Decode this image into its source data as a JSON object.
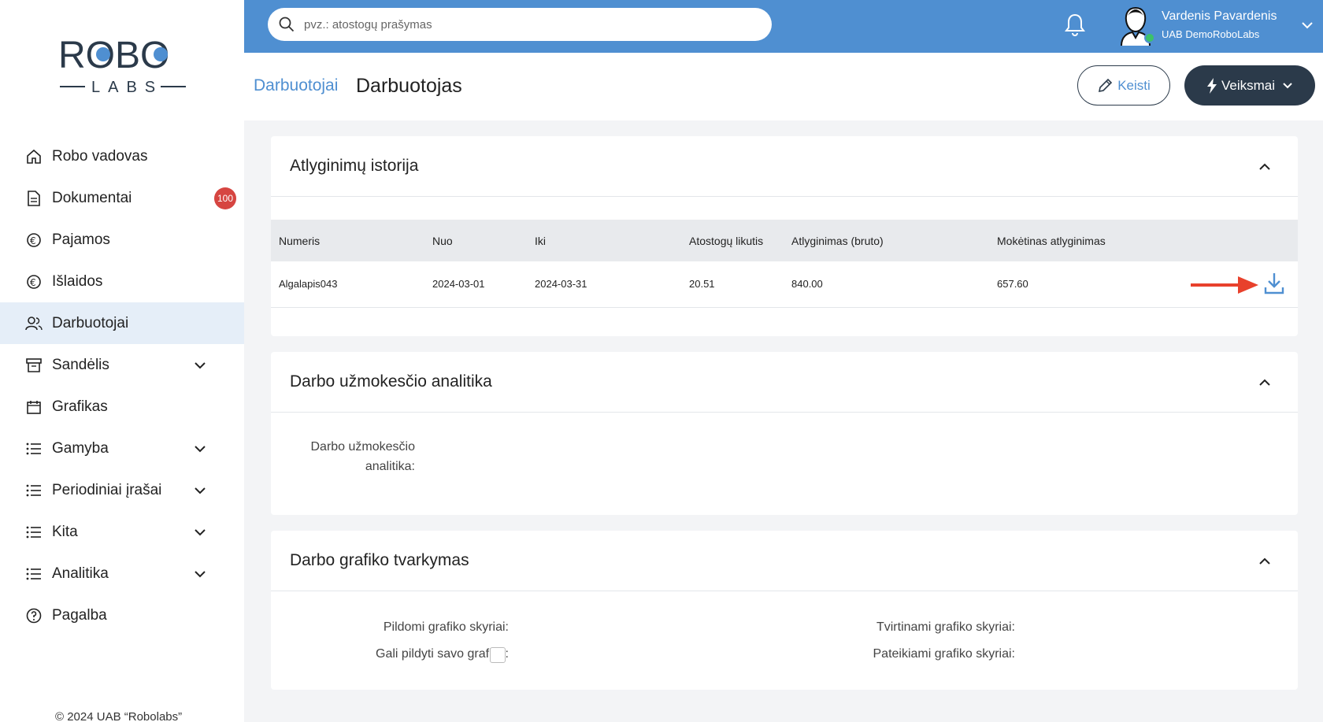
{
  "sidebar": {
    "items": [
      {
        "label": "Robo vadovas",
        "icon": "home-icon"
      },
      {
        "label": "Dokumentai",
        "icon": "document-icon",
        "badge": "100"
      },
      {
        "label": "Pajamos",
        "icon": "euro-income-icon"
      },
      {
        "label": "Išlaidos",
        "icon": "euro-expense-icon"
      },
      {
        "label": "Darbuotojai",
        "icon": "users-icon",
        "active": true
      },
      {
        "label": "Sandėlis",
        "icon": "archive-icon",
        "expandable": true
      },
      {
        "label": "Grafikas",
        "icon": "calendar-icon"
      },
      {
        "label": "Gamyba",
        "icon": "list-icon",
        "expandable": true
      },
      {
        "label": "Periodiniai įrašai",
        "icon": "list-icon",
        "expandable": true
      },
      {
        "label": "Kita",
        "icon": "list-icon",
        "expandable": true
      },
      {
        "label": "Analitika",
        "icon": "list-icon",
        "expandable": true
      },
      {
        "label": "Pagalba",
        "icon": "help-icon"
      }
    ],
    "copyright": "© 2024 UAB “Robolabs”"
  },
  "logo": {
    "top": "ROBO",
    "bottom": "LABS"
  },
  "topbar": {
    "search_placeholder": "pvz.: atostogų prašymas",
    "user_name": "Vardenis Pavardenis",
    "company": "UAB DemoRoboLabs"
  },
  "header": {
    "breadcrumb": "Darbuotojai",
    "title": "Darbuotojas",
    "edit_label": "Keisti",
    "actions_label": "Veiksmai"
  },
  "salary_history": {
    "title": "Atlyginimų istorija",
    "columns": [
      "Numeris",
      "Nuo",
      "Iki",
      "Atostogų likutis",
      "Atlyginimas (bruto)",
      "Mokėtinas atlyginimas"
    ],
    "rows": [
      {
        "number": "Algalapis043",
        "from": "2024-03-01",
        "to": "2024-03-31",
        "vacation": "20.51",
        "gross": "840.00",
        "net": "657.60"
      }
    ]
  },
  "analytics": {
    "title": "Darbo užmokesčio analitika",
    "label_line1": "Darbo užmokesčio",
    "label_line2": "analitika:"
  },
  "schedule": {
    "title": "Darbo grafiko tvarkymas",
    "fill_sections_label": "Pildomi grafiko skyriai:",
    "own_schedule_label": "Gali pildyti savo grafiką:",
    "approve_sections_label": "Tvirtinami grafiko skyriai:",
    "submit_sections_label": "Pateikiami grafiko skyriai:"
  },
  "colors": {
    "brand_blue": "#4f8fd1",
    "dark": "#2b3a4a",
    "badge_red": "#d64541",
    "arrow_red": "#e8412c"
  }
}
